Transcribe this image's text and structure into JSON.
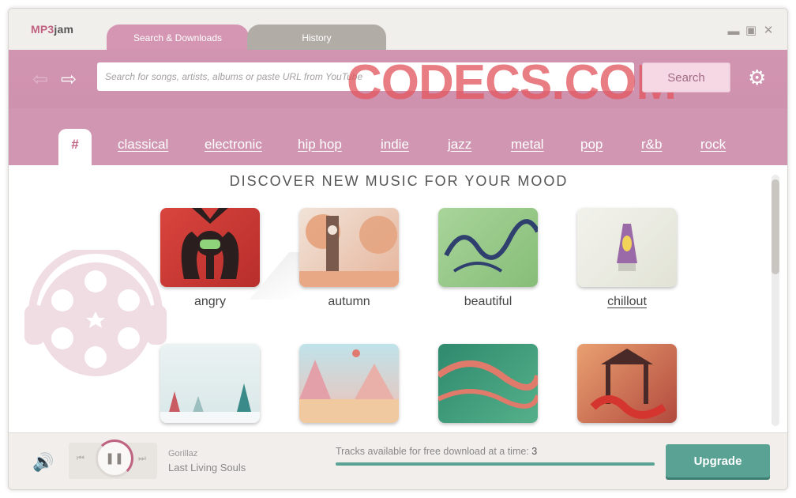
{
  "app": {
    "logo_a": "MP3",
    "logo_b": "jam"
  },
  "tabs": [
    {
      "label": "Search & Downloads",
      "active": true
    },
    {
      "label": "History",
      "active": false
    }
  ],
  "window_controls": [
    "minimize",
    "maximize",
    "close"
  ],
  "search": {
    "placeholder": "Search for songs, artists, albums or paste URL from YouTube",
    "button": "Search"
  },
  "watermark": "CODECS.COM",
  "genres": [
    "#",
    "classical",
    "electronic",
    "hip hop",
    "indie",
    "jazz",
    "metal",
    "pop",
    "r&b",
    "rock"
  ],
  "discover": {
    "heading": "DISCOVER NEW MUSIC FOR YOUR MOOD"
  },
  "moods": [
    {
      "label": "angry",
      "link": false,
      "color": "#d9443e"
    },
    {
      "label": "autumn",
      "link": false,
      "color": "#e8c4b0"
    },
    {
      "label": "beautiful",
      "link": false,
      "color": "#9cc98c"
    },
    {
      "label": "chillout",
      "link": true,
      "color": "#eeeee8"
    },
    {
      "label": "",
      "color": "#dfe9ea"
    },
    {
      "label": "",
      "color": "#e8b7b2"
    },
    {
      "label": "",
      "color": "#3d9a78"
    },
    {
      "label": "",
      "color": "#b9584a"
    }
  ],
  "player": {
    "artist": "Gorillaz",
    "track": "Last Living Souls",
    "progress": 0.3
  },
  "download": {
    "text": "Tracks available for free download at a time: ",
    "count": "3",
    "fill": 1.0
  },
  "upgrade": "Upgrade",
  "colors": {
    "accent": "#c06282",
    "header": "#d194b1",
    "teal": "#5aa294"
  }
}
